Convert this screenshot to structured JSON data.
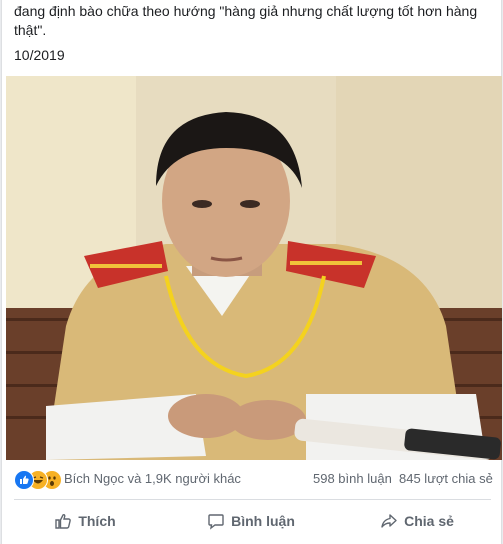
{
  "post": {
    "text": "đang định bào chữa theo hướng \"hàng giả nhưng chất lượng tốt hơn hàng thật\".",
    "date": "10/2019"
  },
  "photo": {
    "background_color": "#e7dcc0",
    "uniform_color": "#d9b978",
    "epaulette_color": "#c8322a"
  },
  "stats": {
    "reactions": [
      "like-icon",
      "haha-icon",
      "wow-icon"
    ],
    "reaction_names": "Bích Ngọc và 1,9K người khác",
    "comments": "598 bình luận",
    "shares": "845 lượt chia sẻ"
  },
  "actions": {
    "like": "Thích",
    "comment": "Bình luận",
    "share": "Chia sẻ"
  },
  "colors": {
    "text": "#1c1e21",
    "secondary": "#606770",
    "like_blue": "#1877f2"
  }
}
